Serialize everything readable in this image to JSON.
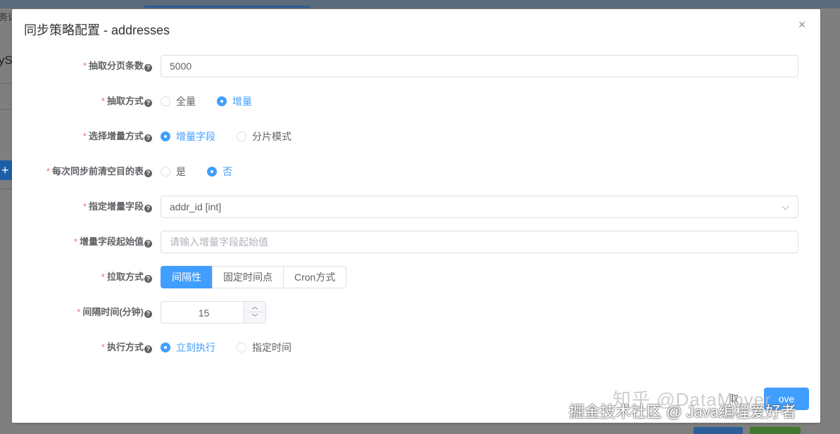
{
  "background": {
    "tab_fragment": "务详",
    "left_text_fragment": "yS",
    "plus_label": "+"
  },
  "dialog": {
    "title": "同步策略配置 - addresses",
    "close_glyph": "×"
  },
  "form": {
    "page_size": {
      "label": "抽取分页条数",
      "value": "5000"
    },
    "extract_mode": {
      "label": "抽取方式",
      "options": [
        "全量",
        "增量"
      ],
      "selected": "增量"
    },
    "incremental_mode": {
      "label": "选择增量方式",
      "options": [
        "增量字段",
        "分片模式"
      ],
      "selected": "增量字段"
    },
    "truncate_target": {
      "label": "每次同步前清空目的表",
      "options": [
        "是",
        "否"
      ],
      "selected": "否"
    },
    "incremental_field": {
      "label": "指定增量字段",
      "value": "addr_id [int]"
    },
    "incremental_start": {
      "label": "增量字段起始值",
      "placeholder": "请输入增量字段起始值",
      "value": ""
    },
    "pull_mode": {
      "label": "拉取方式",
      "options": [
        "间隔性",
        "固定时间点",
        "Cron方式"
      ],
      "selected": "间隔性"
    },
    "interval": {
      "label": "间隔时间(分钟)",
      "value": "15"
    },
    "exec_mode": {
      "label": "执行方式",
      "options": [
        "立刻执行",
        "指定时间"
      ],
      "selected": "立刻执行"
    }
  },
  "footer": {
    "cancel_label": "取",
    "ok_label": "ove"
  },
  "watermark": {
    "line1": "知乎 @DataMover",
    "line2": "掘金技术社区 @ Java编程爱好者"
  },
  "colors": {
    "primary": "#409eff",
    "required": "#f56c6c",
    "overlay": "#7f7f7f"
  }
}
